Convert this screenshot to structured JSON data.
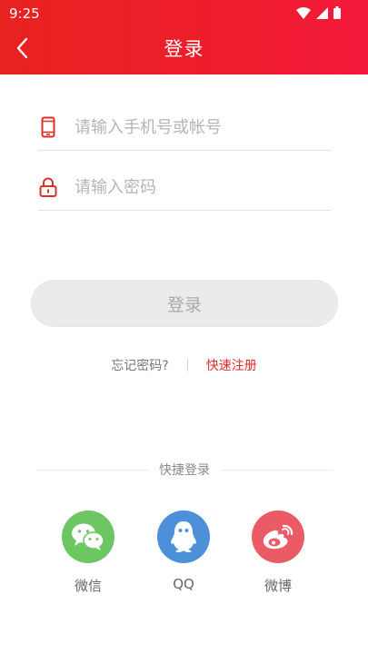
{
  "status_bar": {
    "time": "9:25",
    "icons": [
      "wifi-icon",
      "signal-icon",
      "battery-icon"
    ]
  },
  "header": {
    "title": "登录",
    "back_icon": "chevron-left-icon",
    "color_start": "#e8221f",
    "color_end": "#f21a3a"
  },
  "form": {
    "account": {
      "placeholder": "请输入手机号或帐号",
      "value": "",
      "icon": "phone-icon"
    },
    "password": {
      "placeholder": "请输入密码",
      "value": "",
      "icon": "lock-icon"
    },
    "login_label": "登录"
  },
  "links": {
    "forgot": "忘记密码?",
    "register": "快速注册"
  },
  "quick_login": {
    "title": "快捷登录",
    "providers": [
      {
        "label": "微信",
        "icon": "wechat-icon",
        "color": "#6cc763"
      },
      {
        "label": "QQ",
        "icon": "qq-icon",
        "color": "#4d8fd8"
      },
      {
        "label": "微博",
        "icon": "weibo-icon",
        "color": "#ea5b66"
      }
    ]
  },
  "colors": {
    "accent": "#e22a2a",
    "icon_red": "#d9332e"
  }
}
